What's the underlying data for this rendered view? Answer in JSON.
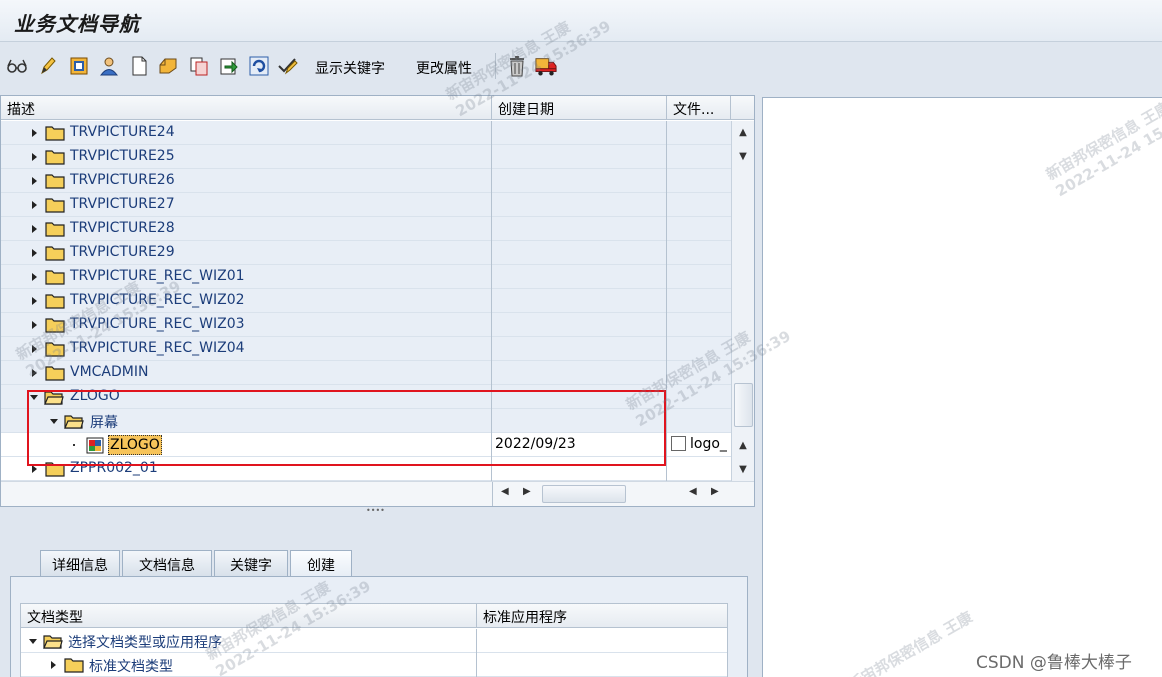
{
  "window": {
    "title": "业务文档导航"
  },
  "toolbar": {
    "show_keywords": "显示关键字",
    "change_attributes": "更改属性",
    "icons": [
      "glasses-icon",
      "pencil-icon",
      "attributes-icon",
      "person-icon",
      "new-document-icon",
      "print-icon",
      "copy-icon",
      "export-icon",
      "refresh-icon",
      "check-edit-icon",
      "trash-icon",
      "transport-truck-icon"
    ]
  },
  "tree": {
    "columns": {
      "description": "描述",
      "created_date": "创建日期",
      "file": "文件..."
    },
    "rows": [
      {
        "label": "TRVPICTURE24",
        "type": "folder",
        "expanded": false,
        "depth": 0
      },
      {
        "label": "TRVPICTURE25",
        "type": "folder",
        "expanded": false,
        "depth": 0
      },
      {
        "label": "TRVPICTURE26",
        "type": "folder",
        "expanded": false,
        "depth": 0
      },
      {
        "label": "TRVPICTURE27",
        "type": "folder",
        "expanded": false,
        "depth": 0
      },
      {
        "label": "TRVPICTURE28",
        "type": "folder",
        "expanded": false,
        "depth": 0
      },
      {
        "label": "TRVPICTURE29",
        "type": "folder",
        "expanded": false,
        "depth": 0
      },
      {
        "label": "TRVPICTURE_REC_WIZ01",
        "type": "folder",
        "expanded": false,
        "depth": 0
      },
      {
        "label": "TRVPICTURE_REC_WIZ02",
        "type": "folder",
        "expanded": false,
        "depth": 0
      },
      {
        "label": "TRVPICTURE_REC_WIZ03",
        "type": "folder",
        "expanded": false,
        "depth": 0
      },
      {
        "label": "TRVPICTURE_REC_WIZ04",
        "type": "folder",
        "expanded": false,
        "depth": 0
      },
      {
        "label": "VMCADMIN",
        "type": "folder",
        "expanded": false,
        "depth": 0
      },
      {
        "label": "ZLOGO",
        "type": "folder",
        "expanded": true,
        "depth": 0
      },
      {
        "label": "屏幕",
        "type": "folder",
        "expanded": true,
        "depth": 1
      },
      {
        "label": "ZLOGO",
        "type": "document",
        "depth": 2,
        "created_date": "2022/09/23",
        "file": "logo_",
        "selected": true
      },
      {
        "label": "ZPPR002_01",
        "type": "folder",
        "expanded": false,
        "depth": 0
      }
    ]
  },
  "tabs": [
    {
      "label": "详细信息"
    },
    {
      "label": "文档信息"
    },
    {
      "label": "关键字"
    },
    {
      "label": "创建",
      "active": true
    }
  ],
  "create_table": {
    "columns": {
      "doc_type": "文档类型",
      "std_app": "标准应用程序"
    },
    "rows": [
      {
        "label": "选择文档类型或应用程序",
        "expanded": true,
        "depth": 0
      },
      {
        "label": "标准文档类型",
        "expanded": false,
        "depth": 1
      }
    ]
  },
  "watermark": {
    "line1": "新宙邦保密信息 王康",
    "line2": "2022-11-24 15:36:39"
  },
  "credit": "CSDN @鲁棒大棒子",
  "colors": {
    "highlight_box": "#e0141e",
    "selected_bg": "#f7c45a",
    "tree_text": "#1c3d7a"
  }
}
